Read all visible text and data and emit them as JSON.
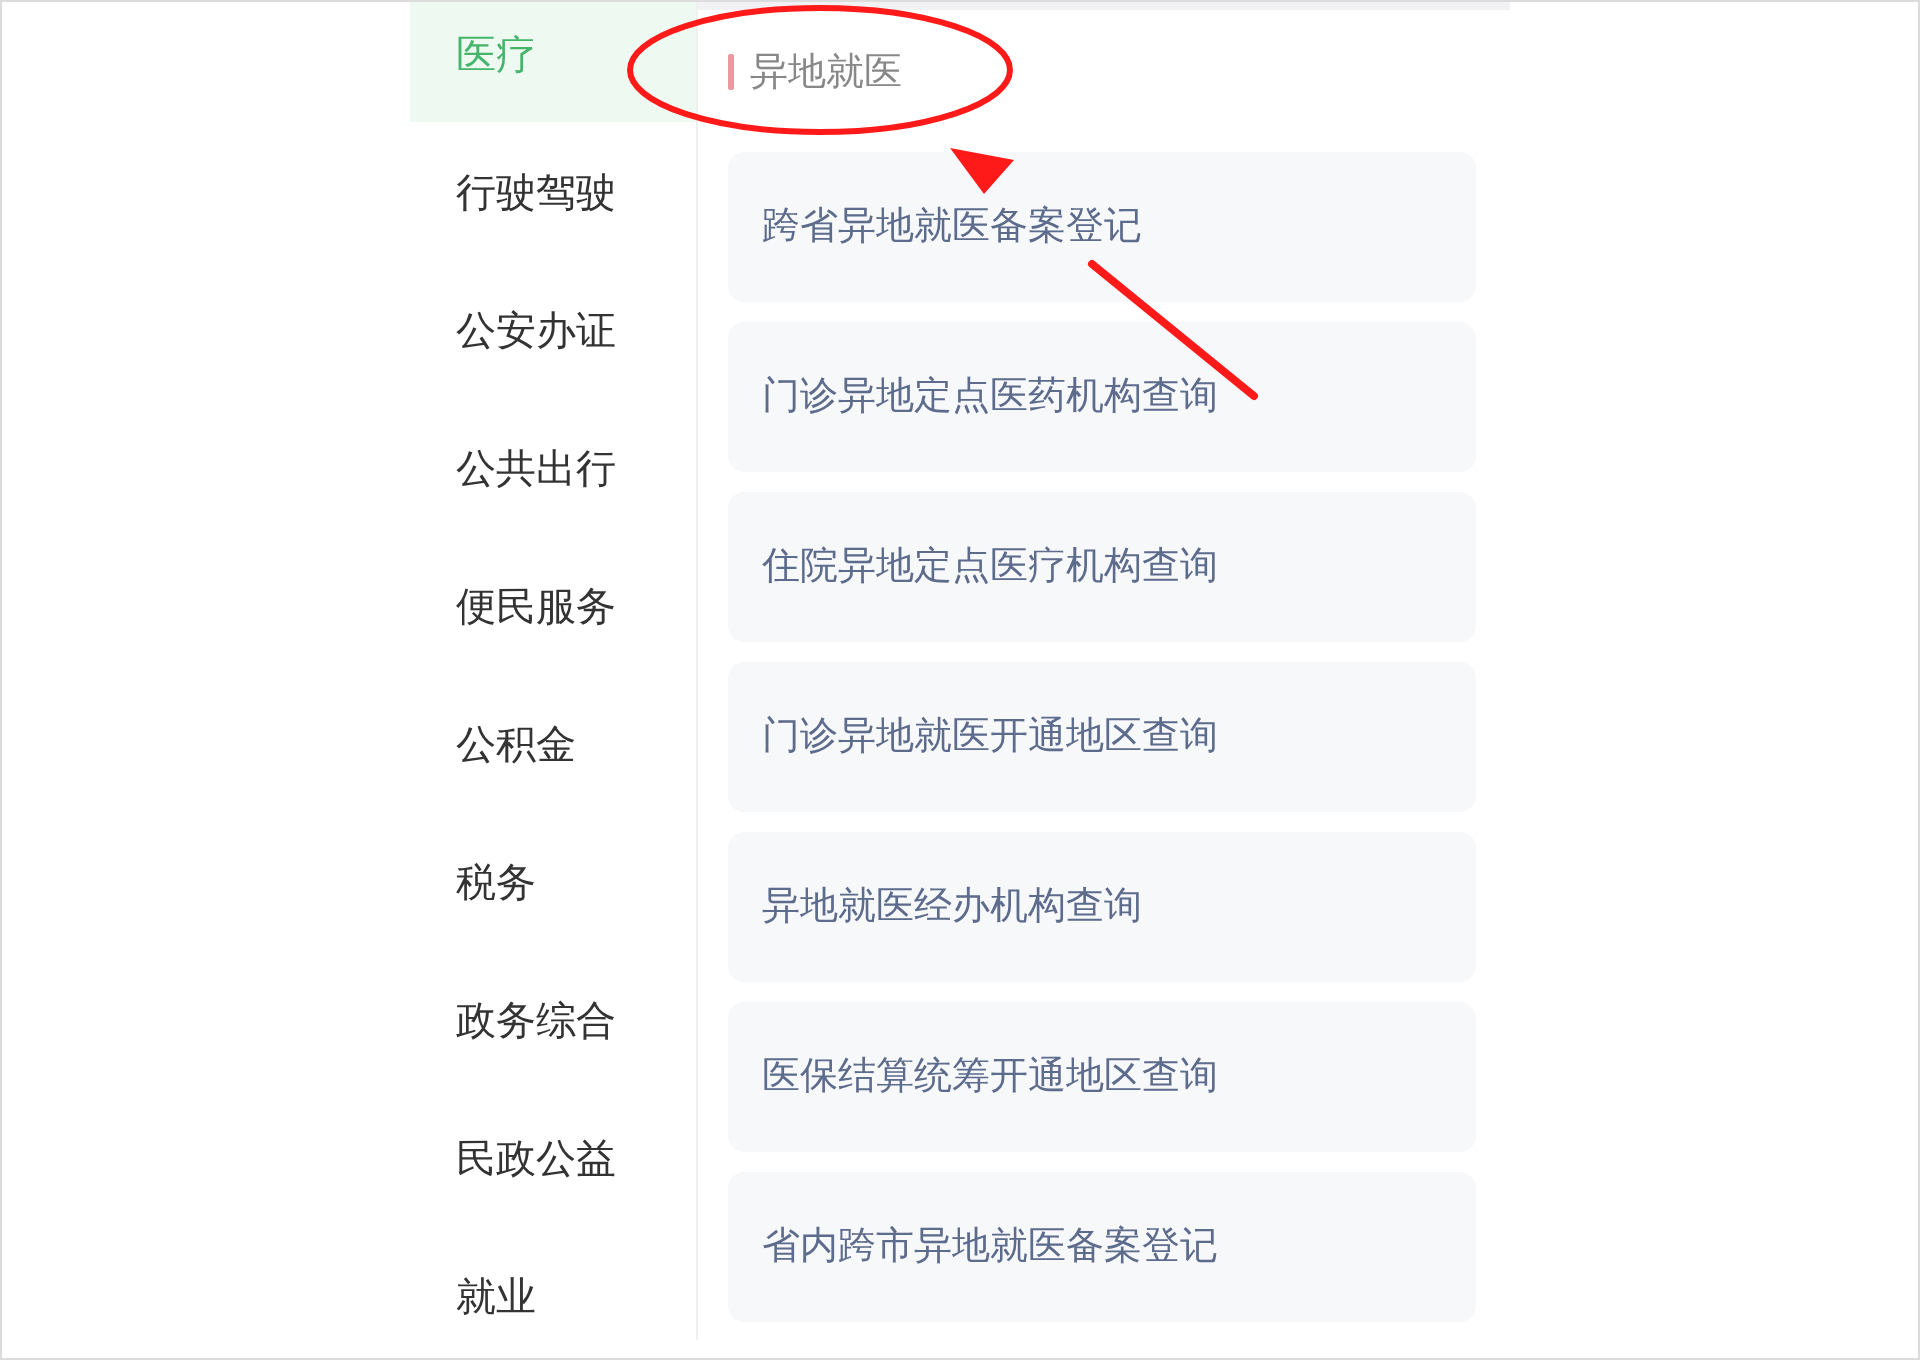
{
  "sidebar": {
    "items": [
      {
        "label": "医疗",
        "selected": true
      },
      {
        "label": "行驶驾驶",
        "selected": false
      },
      {
        "label": "公安办证",
        "selected": false
      },
      {
        "label": "公共出行",
        "selected": false
      },
      {
        "label": "便民服务",
        "selected": false
      },
      {
        "label": "公积金",
        "selected": false
      },
      {
        "label": "税务",
        "selected": false
      },
      {
        "label": "政务综合",
        "selected": false
      },
      {
        "label": "民政公益",
        "selected": false
      },
      {
        "label": "就业",
        "selected": false
      }
    ]
  },
  "section": {
    "title": "异地就医"
  },
  "services": [
    {
      "label": "跨省异地就医备案登记"
    },
    {
      "label": "门诊异地定点医药机构查询"
    },
    {
      "label": "住院异地定点医疗机构查询"
    },
    {
      "label": "门诊异地就医开通地区查询"
    },
    {
      "label": "异地就医经办机构查询"
    },
    {
      "label": "医保结算统筹开通地区查询"
    },
    {
      "label": "省内跨市异地就医备案登记"
    }
  ]
}
